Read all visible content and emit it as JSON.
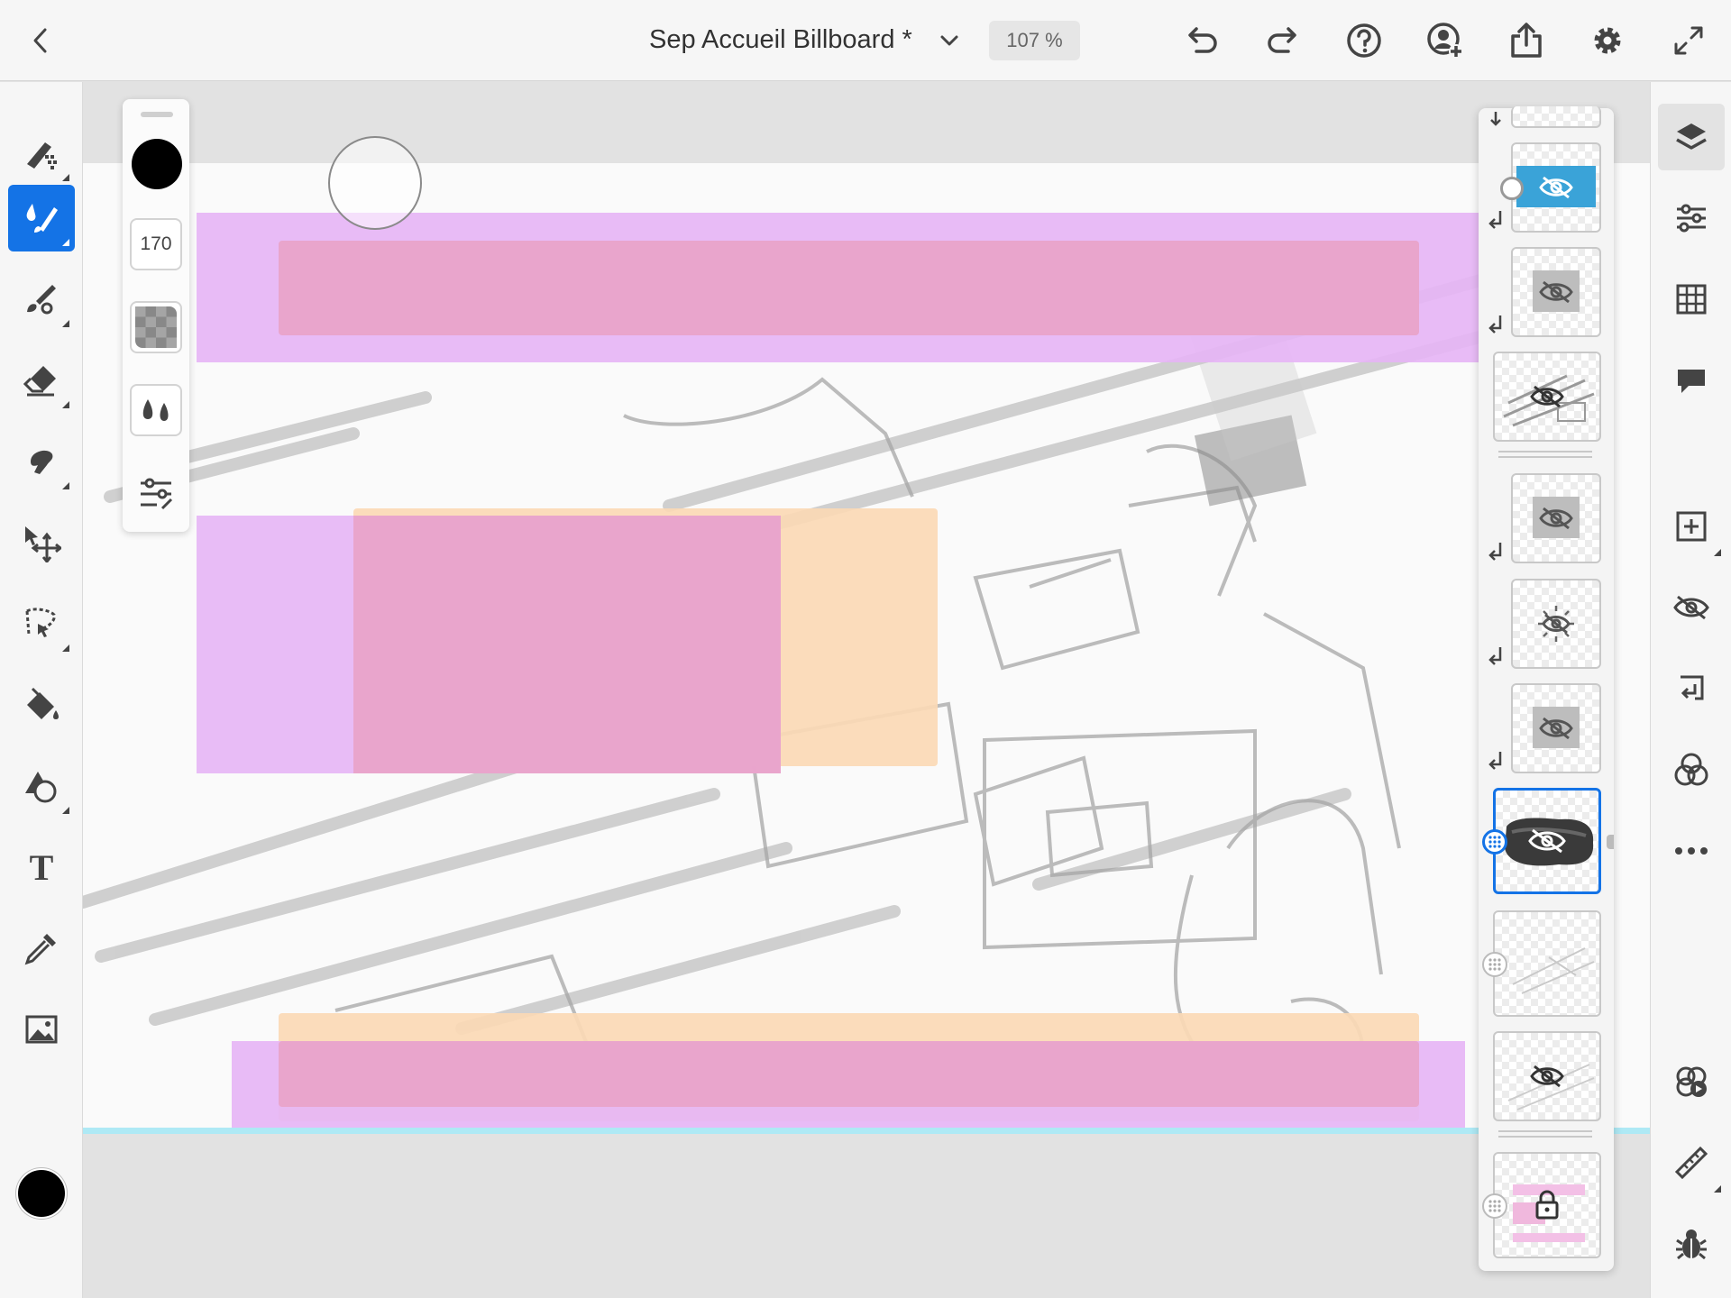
{
  "app": {
    "document_title": "Sep Accueil Billboard *",
    "zoom_label": "107 %"
  },
  "brush_panel": {
    "size_value": "170"
  },
  "colors": {
    "accent": "#1473e6",
    "magenta_block": "#e6b5f5",
    "pink_block": "#e9a3c9",
    "peach_block": "#fbd9b5",
    "artboard_edge": "#aee9f5",
    "current_color": "#000000"
  },
  "top_bar": {
    "icons": [
      "back-chevron-icon",
      "title-dropdown-icon",
      "undo-icon",
      "redo-icon",
      "help-icon",
      "invite-user-icon",
      "share-icon",
      "settings-gear-icon",
      "fullscreen-icon"
    ]
  },
  "left_toolbar": {
    "tools": [
      "pixel-brush-icon",
      "live-brush-icon",
      "vector-brush-icon",
      "eraser-icon",
      "smudge-icon",
      "transform-icon",
      "selection-icon",
      "fill-icon",
      "shapes-icon",
      "text-icon",
      "eyedropper-icon",
      "image-icon"
    ],
    "active_tool": "live-brush-icon",
    "text_tool_glyph": "T"
  },
  "right_rail": {
    "buttons": [
      "layers-icon",
      "layer-properties-icon",
      "grid-icon",
      "comments-icon",
      "add-layer-icon",
      "hide-layer-icon",
      "merge-down-icon",
      "blend-mode-icon",
      "more-icon",
      "libraries-icon",
      "ruler-icon",
      "bug-icon"
    ]
  },
  "layers": {
    "count_visible": 10,
    "selected_index": 6,
    "locked_layer_index": 9
  }
}
